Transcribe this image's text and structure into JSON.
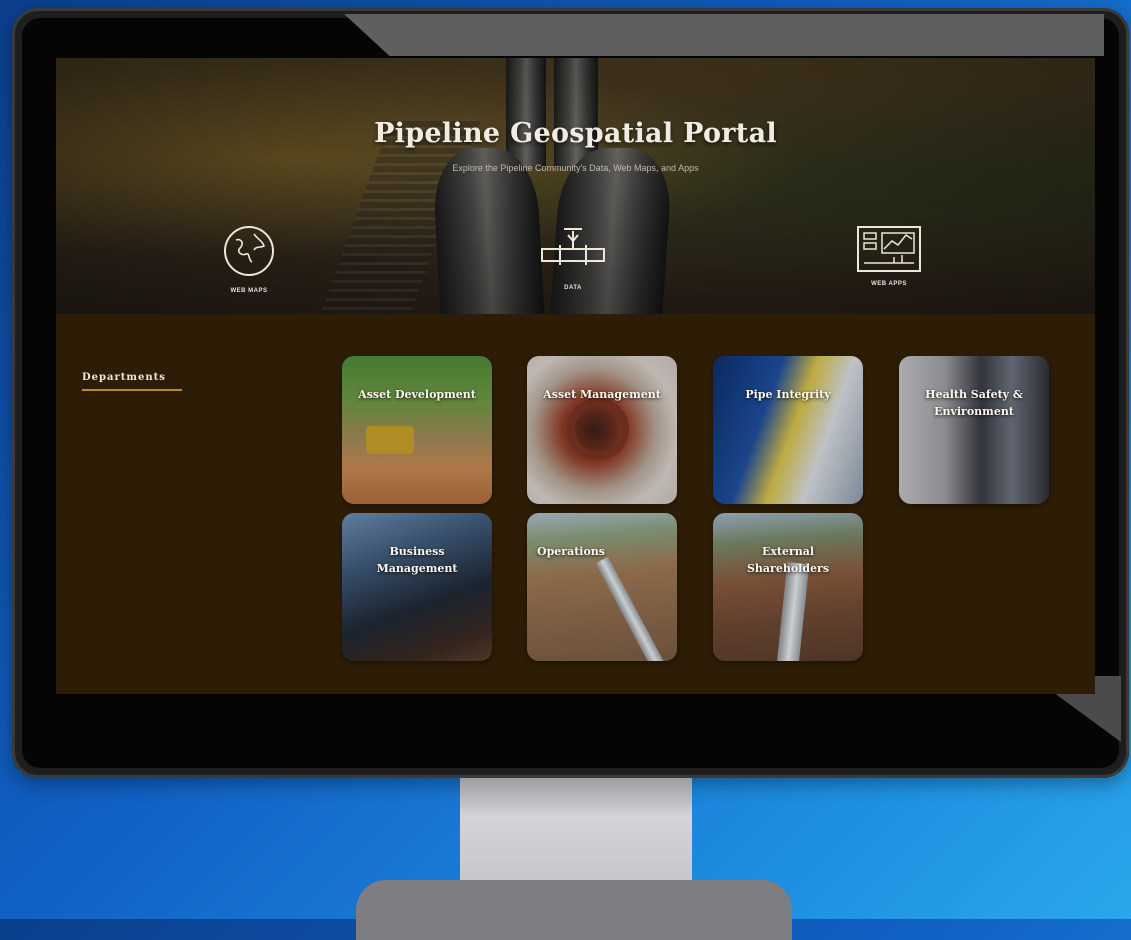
{
  "portal": {
    "title": "Pipeline Geospatial Portal",
    "subtitle": "Explore the Pipeline Community's Data, Web Maps, and Apps"
  },
  "hero_links": [
    {
      "label": "Web Maps",
      "icon": "globe-icon"
    },
    {
      "label": "Data",
      "icon": "pipe-valve-icon"
    },
    {
      "label": "Web Apps",
      "icon": "dashboard-icon"
    }
  ],
  "departments": {
    "heading": "Departments",
    "tiles": [
      {
        "label": "Asset Development"
      },
      {
        "label": "Asset Management"
      },
      {
        "label": "Pipe Integrity"
      },
      {
        "label": "Health Safety & Environment"
      },
      {
        "label": "Business Management"
      },
      {
        "label": "Operations"
      },
      {
        "label": "External Shareholders"
      }
    ]
  },
  "colors": {
    "desktop_background": "#1160c4",
    "screen_background": "#2e1d06",
    "heading_underline": "#b88a2e",
    "title_text": "#f1ece1"
  }
}
